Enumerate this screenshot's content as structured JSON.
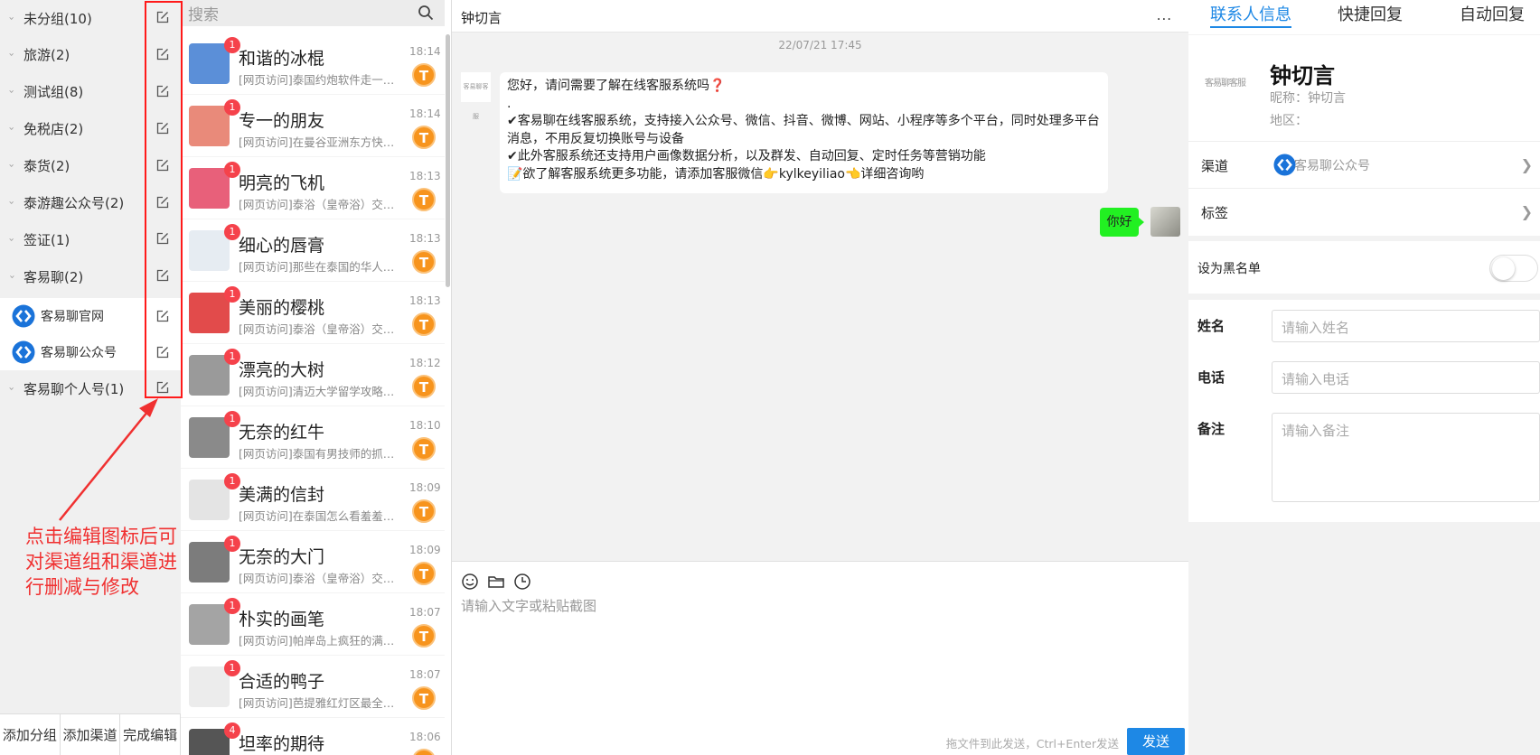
{
  "groups": [
    {
      "name": "未分组(10)",
      "chevron": "›"
    },
    {
      "name": "旅游(2)",
      "chevron": "›"
    },
    {
      "name": "测试组(8)",
      "chevron": "›"
    },
    {
      "name": "免税店(2)",
      "chevron": "›"
    },
    {
      "name": "泰货(2)",
      "chevron": "›"
    },
    {
      "name": "泰游趣公众号(2)",
      "chevron": "›"
    },
    {
      "name": "签证(1)",
      "chevron": "›"
    },
    {
      "name": "客易聊(2)",
      "chevron": "‹"
    }
  ],
  "channels": [
    {
      "name": "客易聊官网"
    },
    {
      "name": "客易聊公众号"
    }
  ],
  "last_group": {
    "name": "客易聊个人号(1)",
    "chevron": "›"
  },
  "annotation": {
    "text": "点击编辑图标后可对渠道组和渠道进行删减与修改",
    "color": "#f03030"
  },
  "bottom_buttons": {
    "add_group": "添加分组",
    "add_channel": "添加渠道",
    "finish_edit": "完成编辑"
  },
  "search": {
    "placeholder": "搜索"
  },
  "conversations": [
    {
      "name": "和谐的冰棍",
      "preview": "[网页访问]泰国约炮软件走一发!-...",
      "time": "18:14",
      "badge": "1",
      "avatar_color": "#5b8fd8"
    },
    {
      "name": "专一的朋友",
      "preview": "[网页访问]在曼谷亚洲东方快车E...",
      "time": "18:14",
      "badge": "1",
      "avatar_color": "#e98a7a"
    },
    {
      "name": "明亮的飞机",
      "preview": "[网页访问]泰浴（皇帝浴）交战...",
      "time": "18:13",
      "badge": "1",
      "avatar_color": "#e8607a"
    },
    {
      "name": "细心的唇膏",
      "preview": "[网页访问]那些在泰国的华人们...",
      "time": "18:13",
      "badge": "1",
      "avatar_color": "#e6ecf2"
    },
    {
      "name": "美丽的樱桃",
      "preview": "[网页访问]泰浴（皇帝浴）交战...",
      "time": "18:13",
      "badge": "1",
      "avatar_color": "#e24b4b"
    },
    {
      "name": "漂亮的大树",
      "preview": "[网页访问]清迈大学留学攻略，...",
      "time": "18:12",
      "badge": "1",
      "avatar_color": "#9a9a9a"
    },
    {
      "name": "无奈的红牛",
      "preview": "[网页访问]泰国有男技师的抓龙...",
      "time": "18:10",
      "badge": "1",
      "avatar_color": "#8a8a8a"
    },
    {
      "name": "美满的信封",
      "preview": "[网页访问]在泰国怎么看羞羞表...",
      "time": "18:09",
      "badge": "1",
      "avatar_color": "#e4e4e4"
    },
    {
      "name": "无奈的大门",
      "preview": "[网页访问]泰浴（皇帝浴）交战...",
      "time": "18:09",
      "badge": "1",
      "avatar_color": "#7c7c7c"
    },
    {
      "name": "朴实的画笔",
      "preview": "[网页访问]帕岸岛上疯狂的满月...",
      "time": "18:07",
      "badge": "1",
      "avatar_color": "#a4a4a4"
    },
    {
      "name": "合适的鸭子",
      "preview": "[网页访问]芭提雅红灯区最全攻...",
      "time": "18:07",
      "badge": "1",
      "avatar_color": "#ececec"
    },
    {
      "name": "坦率的期待",
      "preview": "",
      "time": "18:06",
      "badge": "4",
      "avatar_color": "#555555"
    }
  ],
  "channel_badge_letter": "T",
  "chat": {
    "title": "钟切言",
    "more": "...",
    "timestamp": "22/07/21 17:45",
    "bot_avatar_text": "客易聊客服",
    "incoming_lines": [
      "您好，请问需要了解在线客服系统吗❓",
      ".",
      "✔客易聊在线客服系统，支持接入公众号、微信、抖音、微博、网站、小程序等多个平台，同时处理多平台消息，不用反复切换账号与设备",
      "✔此外客服系统还支持用户画像数据分析，以及群发、自动回复、定时任务等营销功能",
      "📝欲了解客服系统更多功能，请添加客服微信👉kylkeyiliao👈详细咨询哟"
    ],
    "outgoing": "你好",
    "input_placeholder": "请输入文字或粘贴截图",
    "hint": "拖文件到此发送，Ctrl+Enter发送",
    "send": "发送"
  },
  "info": {
    "tabs": [
      "联系人信息",
      "快捷回复",
      "自动回复"
    ],
    "logo_text": "客易聊客服",
    "name": "钟切言",
    "nickname": "昵称：钟切言",
    "region": "地区：",
    "channel_label": "渠道",
    "channel_value": "客易聊公众号",
    "tag_label": "标签",
    "blacklist_label": "设为黑名单",
    "name_label": "姓名",
    "name_placeholder": "请输入姓名",
    "phone_label": "电话",
    "phone_placeholder": "请输入电话",
    "note_label": "备注",
    "note_placeholder": "请输入备注"
  },
  "colors": {
    "accent": "#1e88e5",
    "badge": "#f5424b",
    "channel_badge": "#f7941d",
    "outgoing_bubble": "#22f022",
    "annotation": "#f03030"
  },
  "icons": [
    "edit-icon",
    "search-icon",
    "chevron-icon",
    "emoji-icon",
    "folder-icon",
    "clock-icon",
    "arrow-right-icon",
    "channel-logo-icon"
  ]
}
